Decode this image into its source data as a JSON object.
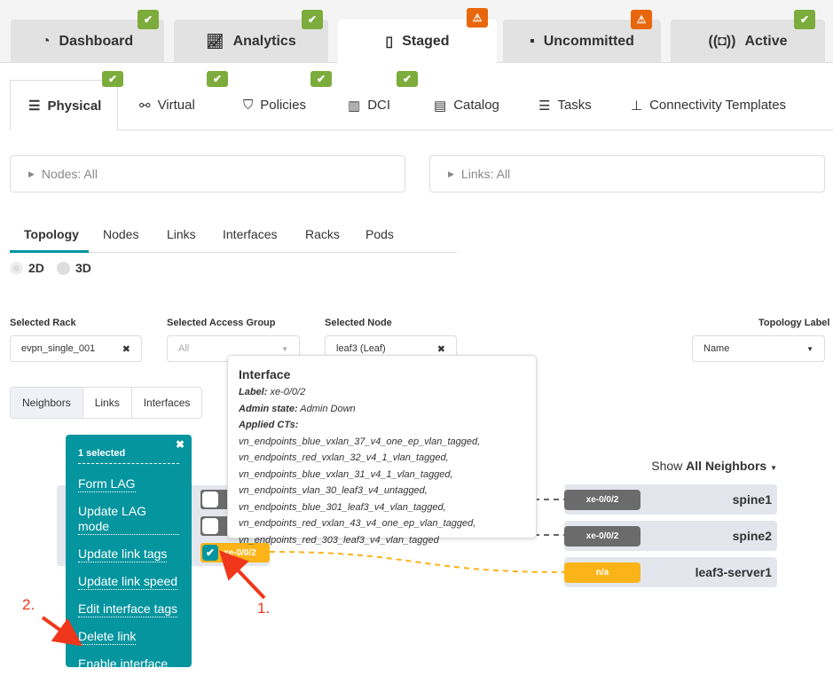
{
  "top_tabs": [
    {
      "label": "Dashboard",
      "icon": "gauge-icon",
      "status": "ok"
    },
    {
      "label": "Analytics",
      "icon": "line-chart-icon",
      "status": "ok"
    },
    {
      "label": "Staged",
      "icon": "document-icon",
      "status": "warning",
      "active": true
    },
    {
      "label": "Uncommitted",
      "icon": "uncommitted-icon",
      "status": "warning"
    },
    {
      "label": "Active",
      "icon": "broadcast-icon",
      "status": "ok"
    }
  ],
  "sub_tabs": [
    {
      "label": "Physical",
      "icon": "server-icon",
      "status": "ok",
      "active": true
    },
    {
      "label": "Virtual",
      "icon": "network-icon",
      "status": "ok"
    },
    {
      "label": "Policies",
      "icon": "shield-icon",
      "status": "ok"
    },
    {
      "label": "DCI",
      "icon": "dci-icon",
      "status": "ok"
    },
    {
      "label": "Catalog",
      "icon": "catalog-icon"
    },
    {
      "label": "Tasks",
      "icon": "list-icon"
    },
    {
      "label": "Connectivity Templates",
      "icon": "hierarchy-icon"
    }
  ],
  "filters": {
    "nodes": "Nodes: All",
    "links": "Links: All"
  },
  "view_tabs": [
    "Topology",
    "Nodes",
    "Links",
    "Interfaces",
    "Racks",
    "Pods"
  ],
  "view_mode": {
    "options": [
      "2D",
      "3D"
    ],
    "selected": "2D"
  },
  "selectors": {
    "rack": {
      "label": "Selected Rack",
      "value": "evpn_single_001"
    },
    "access_group": {
      "label": "Selected Access Group",
      "placeholder": "All"
    },
    "node": {
      "label": "Selected Node",
      "value": "leaf3 (Leaf)"
    },
    "topology_label": {
      "label": "Topology Label",
      "value": "Name"
    }
  },
  "neighbor_tabs": [
    "Neighbors",
    "Links",
    "Interfaces"
  ],
  "show_neighbors": {
    "prefix": "Show",
    "value": "All Neighbors"
  },
  "tooltip": {
    "title": "Interface",
    "label_key": "Label:",
    "label_value": "xe-0/0/2",
    "admin_key": "Admin state:",
    "admin_value": "Admin Down",
    "cts_key": "Applied CTs:",
    "cts": [
      "vn_endpoints_blue_vxlan_37_v4_one_ep_vlan_tagged,",
      "vn_endpoints_red_vxlan_32_v4_1_vlan_tagged,",
      "vn_endpoints_blue_vxlan_31_v4_1_vlan_tagged,",
      "vn_endpoints_vlan_30_leaf3_v4_untagged,",
      "vn_endpoints_blue_301_leaf3_v4_vlan_tagged,",
      "vn_endpoints_red_vxlan_43_v4_one_ep_vlan_tagged,",
      "vn_endpoints_red_303_leaf3_v4_vlan_tagged"
    ]
  },
  "menu": {
    "title": "1 selected",
    "items": [
      "Form LAG",
      "Update LAG mode",
      "Update link tags",
      "Update link speed",
      "Edit interface tags",
      "Delete link",
      "Enable interface"
    ]
  },
  "selected_interface": "xe-0/0/2",
  "neighbors": [
    {
      "name": "spine1",
      "interface": "xe-0/0/2",
      "color": "#6b6b6b"
    },
    {
      "name": "spine2",
      "interface": "xe-0/0/2",
      "color": "#6b6b6b"
    },
    {
      "name": "leaf3-server1",
      "interface": "n/a",
      "color": "#fbb418"
    }
  ],
  "annotations": {
    "step1": "1.",
    "step2": "2."
  },
  "colors": {
    "ok": "#7cac3b",
    "warning": "#e8670c",
    "menu": "#05959f",
    "selected": "#fbb418",
    "annotation": "#f0371b"
  }
}
